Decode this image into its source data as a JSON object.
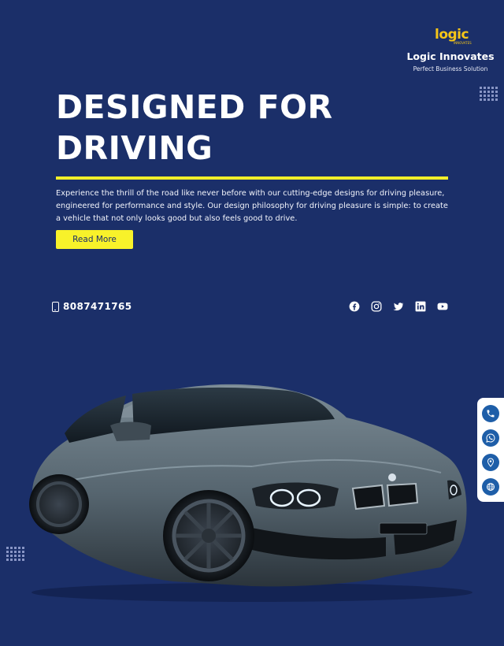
{
  "brand": {
    "logo_text": "logic",
    "logo_subtext": "INNOVATES",
    "name": "Logic Innovates",
    "tagline": "Perfect Business Solution"
  },
  "hero": {
    "headline_line1": "DESIGNED FOR",
    "headline_line2": "DRIVING",
    "description": "Experience the thrill of the road like never before with our cutting-edge designs for driving pleasure, engineered for performance and style. Our design philosophy for driving pleasure is simple: to create a vehicle that not only looks good but also feels good to drive.",
    "cta_label": "Read More"
  },
  "contact": {
    "phone_number": "8087471765"
  },
  "socials": [
    "facebook-icon",
    "instagram-icon",
    "twitter-icon",
    "linkedin-icon",
    "youtube-icon"
  ],
  "float_buttons": [
    "phone-icon",
    "whatsapp-icon",
    "location-icon",
    "globe-icon"
  ],
  "colors": {
    "background": "#1b2f69",
    "accent_yellow": "#f8f22a",
    "logo_yellow": "#f5c518",
    "float_button_blue": "#1e5ea8"
  }
}
